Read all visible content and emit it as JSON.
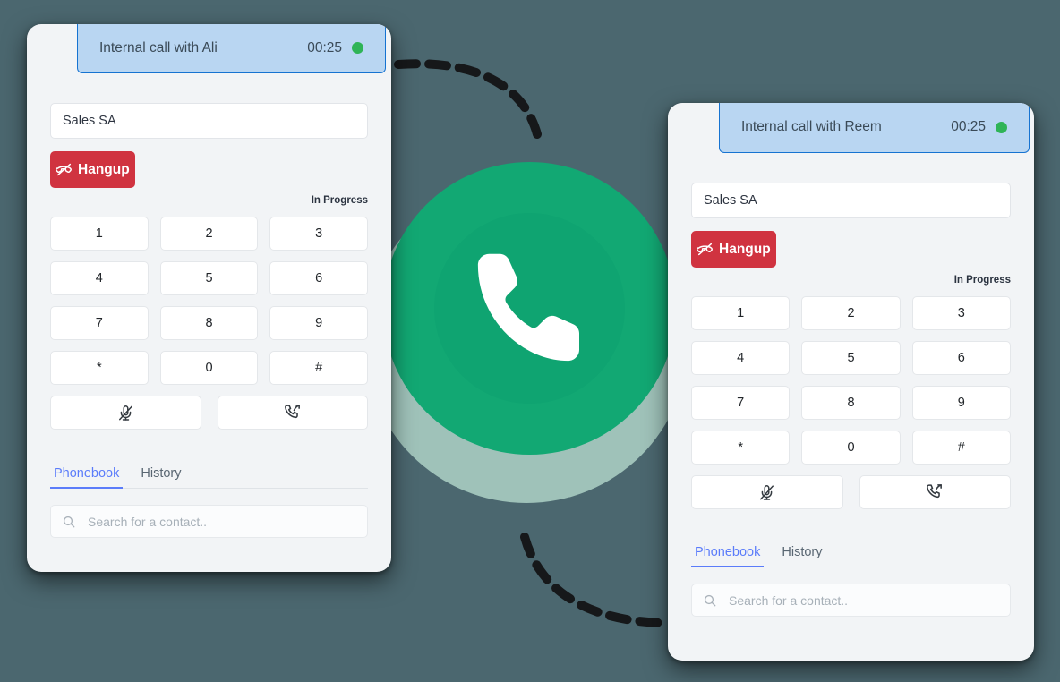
{
  "theme": {
    "page_background": "#4b676f",
    "panel_background": "#f2f4f6",
    "accent_green": "#12a873",
    "halo_green": "#bfe6d6",
    "status_dot_green": "#2fb457",
    "banner_blue_fill": "#b9d6f2",
    "banner_blue_border": "#1673d1",
    "hangup_red": "#d03340",
    "tab_active_blue": "#5b7cfa"
  },
  "center_graphic": {
    "icon": "phone-handset-icon"
  },
  "panels": [
    {
      "id": "left",
      "banner": {
        "title": "Internal call with Ali",
        "timer": "00:25",
        "status_icon": "status-dot-online"
      },
      "number_field": {
        "value": "Sales SA",
        "placeholder": "Sales SA"
      },
      "hangup": {
        "label": "Hangup",
        "icon": "phone-hangup-icon"
      },
      "call_status": "In Progress",
      "keypad": [
        "1",
        "2",
        "3",
        "4",
        "5",
        "6",
        "7",
        "8",
        "9",
        "*",
        "0",
        "#"
      ],
      "actions": [
        {
          "name": "mute",
          "icon": "microphone-muted-icon"
        },
        {
          "name": "transfer",
          "icon": "phone-transfer-icon"
        }
      ],
      "tabs": [
        {
          "label": "Phonebook",
          "active": true
        },
        {
          "label": "History",
          "active": false
        }
      ],
      "search": {
        "placeholder": "Search for a contact..",
        "value": "",
        "icon": "search-icon"
      }
    },
    {
      "id": "right",
      "banner": {
        "title": "Internal call with Reem",
        "timer": "00:25",
        "status_icon": "status-dot-online"
      },
      "number_field": {
        "value": "Sales SA",
        "placeholder": "Sales SA"
      },
      "hangup": {
        "label": "Hangup",
        "icon": "phone-hangup-icon"
      },
      "call_status": "In Progress",
      "keypad": [
        "1",
        "2",
        "3",
        "4",
        "5",
        "6",
        "7",
        "8",
        "9",
        "*",
        "0",
        "#"
      ],
      "actions": [
        {
          "name": "mute",
          "icon": "microphone-muted-icon"
        },
        {
          "name": "transfer",
          "icon": "phone-transfer-icon"
        }
      ],
      "tabs": [
        {
          "label": "Phonebook",
          "active": true
        },
        {
          "label": "History",
          "active": false
        }
      ],
      "search": {
        "placeholder": "Search for a contact..",
        "value": "",
        "icon": "search-icon"
      }
    }
  ]
}
